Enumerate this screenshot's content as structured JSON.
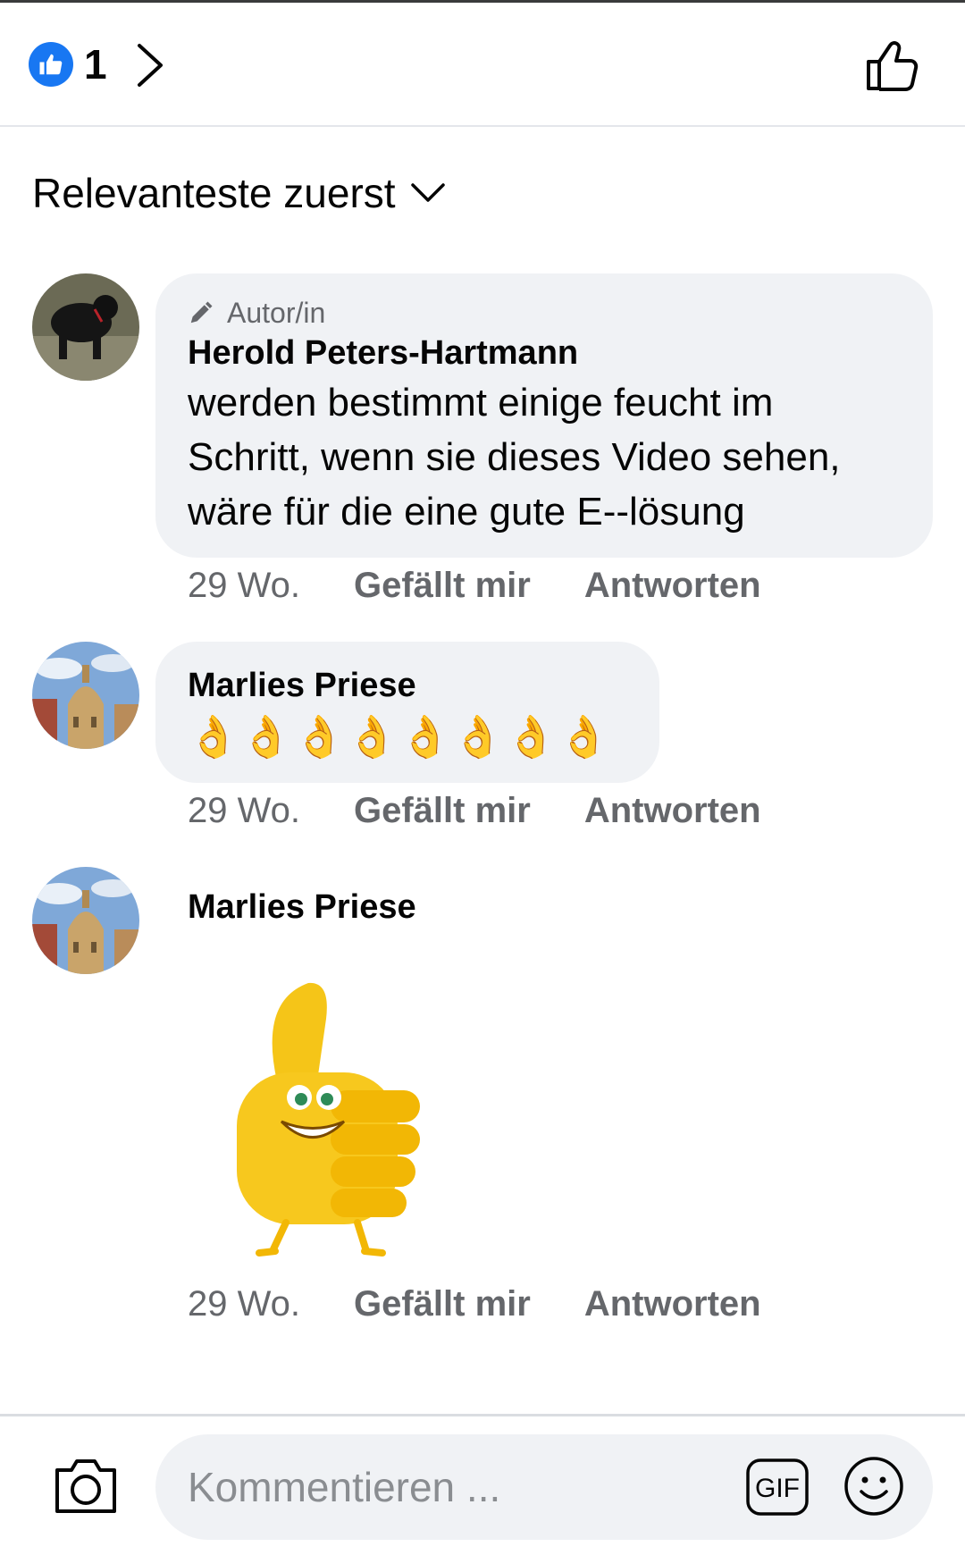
{
  "header": {
    "like_count": "1"
  },
  "sort": {
    "label": "Relevanteste zuerst"
  },
  "comments": [
    {
      "badge": "Autor/in",
      "name": "Herold Peters-Hartmann",
      "text_lines": [
        "werden bestimmt einige feucht im",
        "Schritt, wenn sie dieses Video sehen,",
        "wäre für die eine gute E--lösung"
      ],
      "time": "29 Wo.",
      "like_label": "Gefällt mir",
      "reply_label": "Antworten"
    },
    {
      "name": "Marlies Priese",
      "emoji": "👌👌👌👌👌👌👌👌",
      "time": "29 Wo.",
      "like_label": "Gefällt mir",
      "reply_label": "Antworten"
    },
    {
      "name": "Marlies Priese",
      "sticker": "thumbs-up-sticker",
      "time": "29 Wo.",
      "like_label": "Gefällt mir",
      "reply_label": "Antworten"
    }
  ],
  "composer": {
    "placeholder": "Kommentieren ...",
    "gif_label": "GIF"
  },
  "colors": {
    "accent": "#1877f2",
    "bubble": "#f0f2f5",
    "meta": "#65676b"
  }
}
